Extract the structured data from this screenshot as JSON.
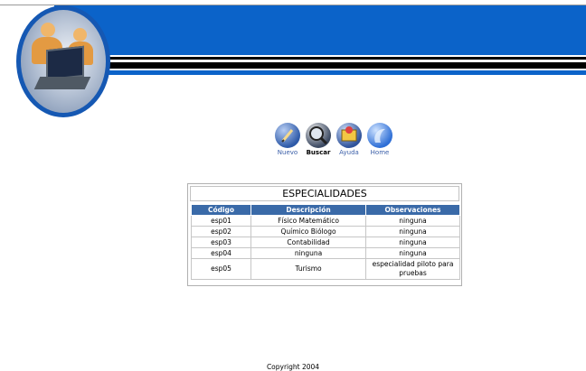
{
  "toolbar": {
    "items": [
      {
        "label": "Nuevo",
        "icon": "pencil-icon"
      },
      {
        "label": "Buscar",
        "icon": "search-icon"
      },
      {
        "label": "Ayuda",
        "icon": "help-icon"
      },
      {
        "label": "Home",
        "icon": "home-icon"
      }
    ]
  },
  "panel": {
    "title": "ESPECIALIDADES",
    "columns": [
      "Código",
      "Descripción",
      "Observaciones"
    ],
    "rows": [
      [
        "esp01",
        "Físico Matemático",
        "ninguna"
      ],
      [
        "esp02",
        "Químico Biólogo",
        "ninguna"
      ],
      [
        "esp03",
        "Contabilidad",
        "ninguna"
      ],
      [
        "esp04",
        "ninguna",
        "ninguna"
      ],
      [
        "esp05",
        "Turismo",
        "especialidad piloto para pruebas"
      ]
    ]
  },
  "footer": {
    "copyright": "Copyright 2004"
  },
  "colors": {
    "banner": "#0b63c9",
    "header": "#3a6aa8",
    "accent": "#1558b3"
  }
}
